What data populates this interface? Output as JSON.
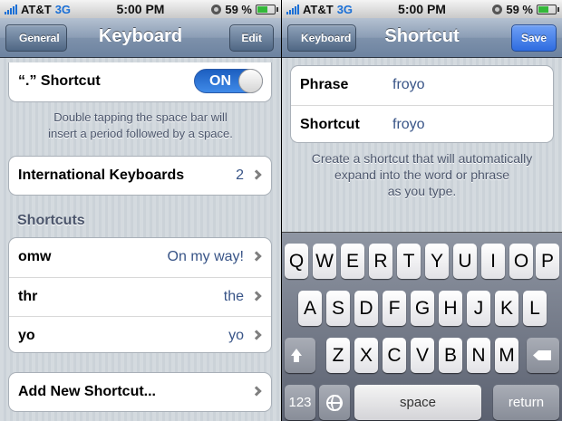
{
  "status_bar": {
    "carrier": "AT&T",
    "network": "3G",
    "time": "5:00 PM",
    "battery_percent": "59 %",
    "battery_level": 0.59,
    "signal_bars": 5,
    "colors": {
      "network": "#1a6fd6",
      "battery": "#34b83a"
    }
  },
  "left_screen": {
    "navbar": {
      "back_label": "General",
      "title": "Keyboard",
      "edit_label": "Edit"
    },
    "period_shortcut": {
      "label": "“.” Shortcut",
      "toggle_state": "ON"
    },
    "period_footnote_line1": "Double tapping the space bar will",
    "period_footnote_line2": "insert a period followed by a space.",
    "international": {
      "label": "International Keyboards",
      "count": "2"
    },
    "shortcuts_header": "Shortcuts",
    "shortcuts": [
      {
        "shortcut": "omw",
        "phrase": "On my way!"
      },
      {
        "shortcut": "thr",
        "phrase": "the"
      },
      {
        "shortcut": "yo",
        "phrase": "yo"
      }
    ],
    "add_new_label": "Add New Shortcut..."
  },
  "right_screen": {
    "navbar": {
      "back_label": "Keyboard",
      "title": "Shortcut",
      "save_label": "Save"
    },
    "phrase_label": "Phrase",
    "phrase_value": "froyo",
    "shortcut_label": "Shortcut",
    "shortcut_value": "froyo",
    "hint_line1": "Create a shortcut that will automatically",
    "hint_line2": "expand into the word or phrase",
    "hint_line3": "as you type.",
    "keyboard": {
      "row1": [
        "Q",
        "W",
        "E",
        "R",
        "T",
        "Y",
        "U",
        "I",
        "O",
        "P"
      ],
      "row2": [
        "A",
        "S",
        "D",
        "F",
        "G",
        "H",
        "J",
        "K",
        "L"
      ],
      "row3": [
        "Z",
        "X",
        "C",
        "V",
        "B",
        "N",
        "M"
      ],
      "numbers_label": "123",
      "space_label": "space",
      "return_label": "return",
      "icons": {
        "shift": "shift-arrow-icon",
        "delete": "backspace-icon",
        "globe": "globe-icon"
      }
    }
  },
  "colors": {
    "toggle_on": "#2a6fd6",
    "save_button": "#2e6ce0",
    "value_text": "#385487",
    "section_text": "#4c566c"
  }
}
